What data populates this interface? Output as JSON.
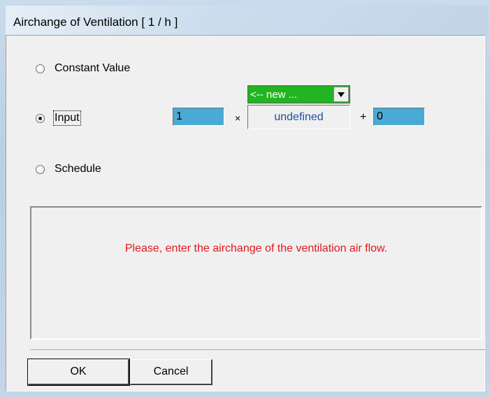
{
  "window": {
    "title": "Airchange of Ventilation  [ 1 / h ]"
  },
  "options": {
    "constant_label": "Constant Value",
    "input_label": "Input",
    "schedule_label": "Schedule",
    "selected": "input"
  },
  "formula": {
    "factor_value": "1",
    "multiply_symbol": "×",
    "dropdown_value": "<-- new ...",
    "reference_value": "undefined",
    "plus_symbol": "+",
    "offset_value": "0"
  },
  "message": {
    "text": "Please, enter the airchange of the ventilation air flow."
  },
  "buttons": {
    "ok_label": "OK",
    "cancel_label": "Cancel"
  },
  "colors": {
    "input_field": "#4aaad6",
    "dropdown": "#22b422",
    "message_text": "#e0181d",
    "reference_text": "#1f4f9c"
  }
}
